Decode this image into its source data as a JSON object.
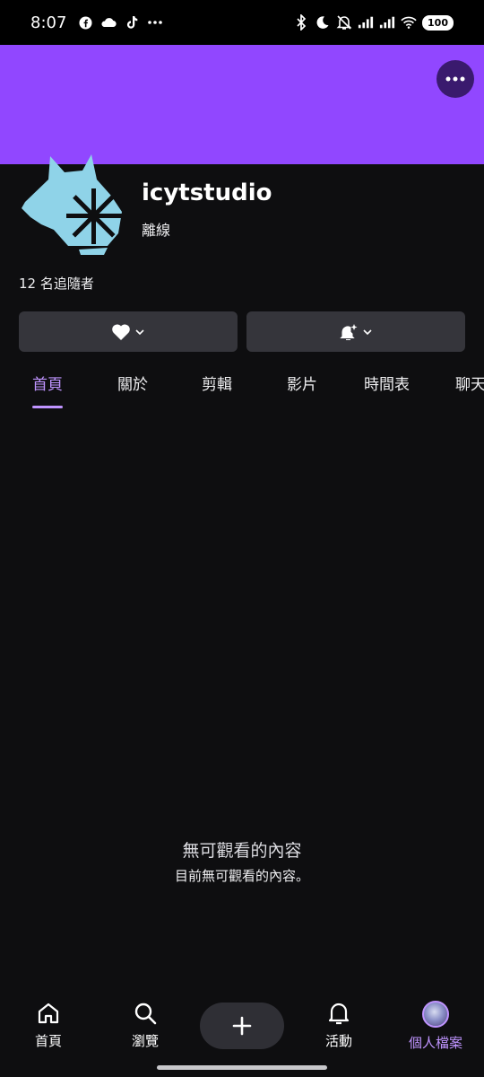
{
  "status_bar": {
    "time": "8:07",
    "battery": "100"
  },
  "channel": {
    "name": "icytstudio",
    "status": "離線",
    "followers": "12 名追隨者"
  },
  "tabs": [
    {
      "label": "首頁",
      "active": true
    },
    {
      "label": "關於",
      "active": false
    },
    {
      "label": "剪輯",
      "active": false
    },
    {
      "label": "影片",
      "active": false
    },
    {
      "label": "時間表",
      "active": false
    },
    {
      "label": "聊天",
      "active": false
    }
  ],
  "empty_state": {
    "title": "無可觀看的內容",
    "subtitle": "目前無可觀看的內容。"
  },
  "bottom_nav": {
    "home": "首頁",
    "browse": "瀏覽",
    "activity": "活動",
    "profile": "個人檔案"
  },
  "colors": {
    "accent": "#9147ff",
    "accent_light": "#bf94ff",
    "background": "#0e0e10",
    "avatar": "#8fd3e8"
  }
}
